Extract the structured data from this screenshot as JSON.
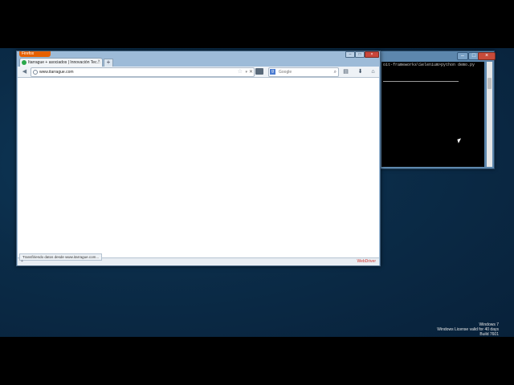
{
  "browser": {
    "app_button": "Firefox",
    "tab": {
      "title": "Itarrague + asociados | Innovación Tec...",
      "close": "×"
    },
    "new_tab": "+",
    "url": "www.itarrague.com",
    "search_engine": "g",
    "search_placeholder": "Google",
    "status_text": "Transfiriendo datos desde www.itarrague.com...",
    "status_left": "+",
    "webdriver_label": "WebDriver",
    "colors": {
      "firefox_orange": "#e66000",
      "webdriver_red": "#d0342c"
    }
  },
  "console": {
    "command": "oit-frameworks\\Selenium>python demo.py"
  },
  "watermark": {
    "line1": "Windows 7",
    "line2": "Windows License valid for 40 days",
    "line3": "Build 7601"
  }
}
